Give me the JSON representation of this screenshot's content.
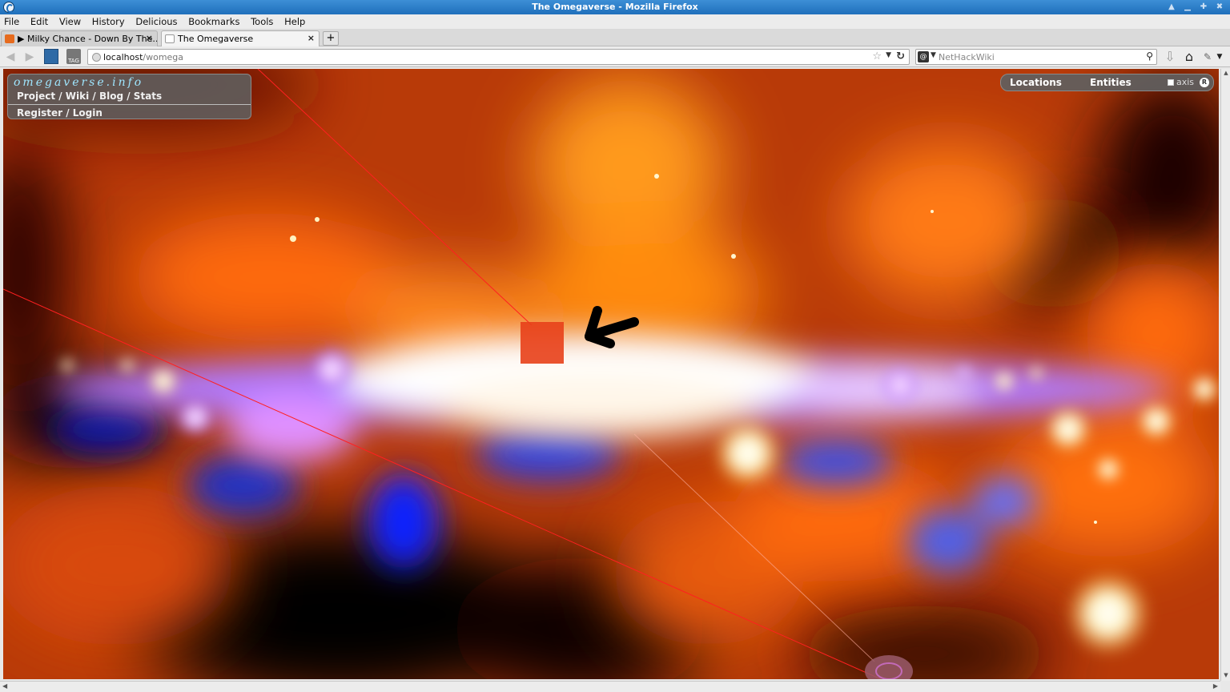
{
  "window": {
    "title": "The Omegaverse - Mozilla Firefox"
  },
  "menu": [
    "File",
    "Edit",
    "View",
    "History",
    "Delicious",
    "Bookmarks",
    "Tools",
    "Help"
  ],
  "tabs": [
    {
      "label": "▶ Milky Chance - Down By The...",
      "active": false
    },
    {
      "label": "The Omegaverse",
      "active": true
    }
  ],
  "newtab_label": "+",
  "address": {
    "host": "localhost",
    "path": "/womega"
  },
  "search": {
    "engine": "NetHackWiki",
    "placeholder": "NetHackWiki"
  },
  "site": {
    "logo": "omegaverse.info",
    "links": "Project / Wiki / Blog / Stats",
    "auth": "Register / Login"
  },
  "nav_panel": {
    "locations": "Locations",
    "entities": "Entities",
    "axis_label": "axis",
    "axis_checked": false,
    "reset_label": "R"
  }
}
